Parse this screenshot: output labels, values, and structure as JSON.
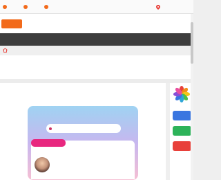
{
  "topbar": {
    "items": [
      {
        "icon": "orange-dot-icon",
        "color": "#f26a1b",
        "label": ""
      },
      {
        "icon": "orange-dot-icon",
        "color": "#f26a1b",
        "label": ""
      },
      {
        "icon": "orange-dot-icon",
        "color": "#f26a1b",
        "label": ""
      }
    ],
    "right": {
      "icon": "location-pin-icon",
      "color": "#e8403a",
      "label": ""
    }
  },
  "header": {
    "logo_badge_text": "",
    "logo_text": "",
    "brand_color": "#f26a1b"
  },
  "nav": {
    "items": [
      "",
      "",
      "",
      "",
      "",
      "",
      ""
    ]
  },
  "breadcrumb": {
    "icon": "home-icon",
    "text": ""
  },
  "page": {
    "title": "",
    "meta": ""
  },
  "article": {
    "first_line": "",
    "phone": {
      "search_text": "",
      "badge": "",
      "badge_color": "#e8277f",
      "profile_name": ""
    }
  },
  "sidebar": {
    "logo_icon": "rainbow-petal-logo-icon",
    "buttons": [
      {
        "color": "#3a76e0"
      },
      {
        "color": "#2db35a"
      },
      {
        "color": "#e8403a"
      }
    ]
  }
}
